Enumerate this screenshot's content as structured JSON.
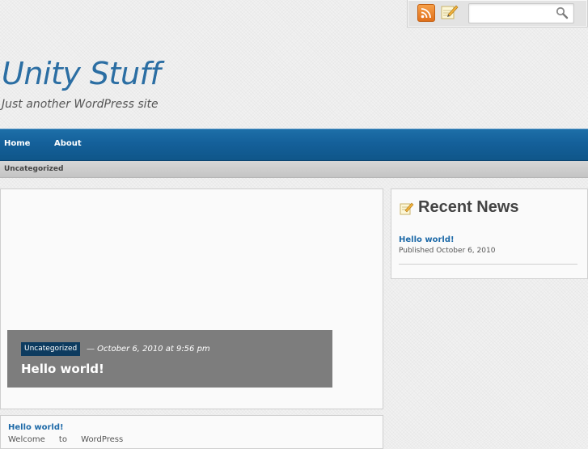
{
  "header": {
    "title": "Unity Stuff",
    "tagline": "Just another WordPress site"
  },
  "toolbar": {
    "icons": [
      "rss-icon",
      "write-icon",
      "search-icon"
    ],
    "search_value": ""
  },
  "nav": {
    "items": [
      {
        "label": "Home"
      },
      {
        "label": "About"
      }
    ]
  },
  "category_bar": {
    "label": "Uncategorized"
  },
  "featured_post": {
    "category": "Uncategorized",
    "meta": "— October 6, 2010 at 9:56 pm",
    "title": "Hello world!"
  },
  "excerpt": {
    "title": "Hello world!",
    "text": "Welcome to WordPress"
  },
  "sidebar": {
    "widget_title": "Recent News",
    "items": [
      {
        "title": "Hello world!",
        "published": "Published October 6, 2010"
      }
    ]
  },
  "colors": {
    "accent": "#2b6ea3",
    "nav_bg": "#14609a",
    "link": "#1e6aa8"
  }
}
